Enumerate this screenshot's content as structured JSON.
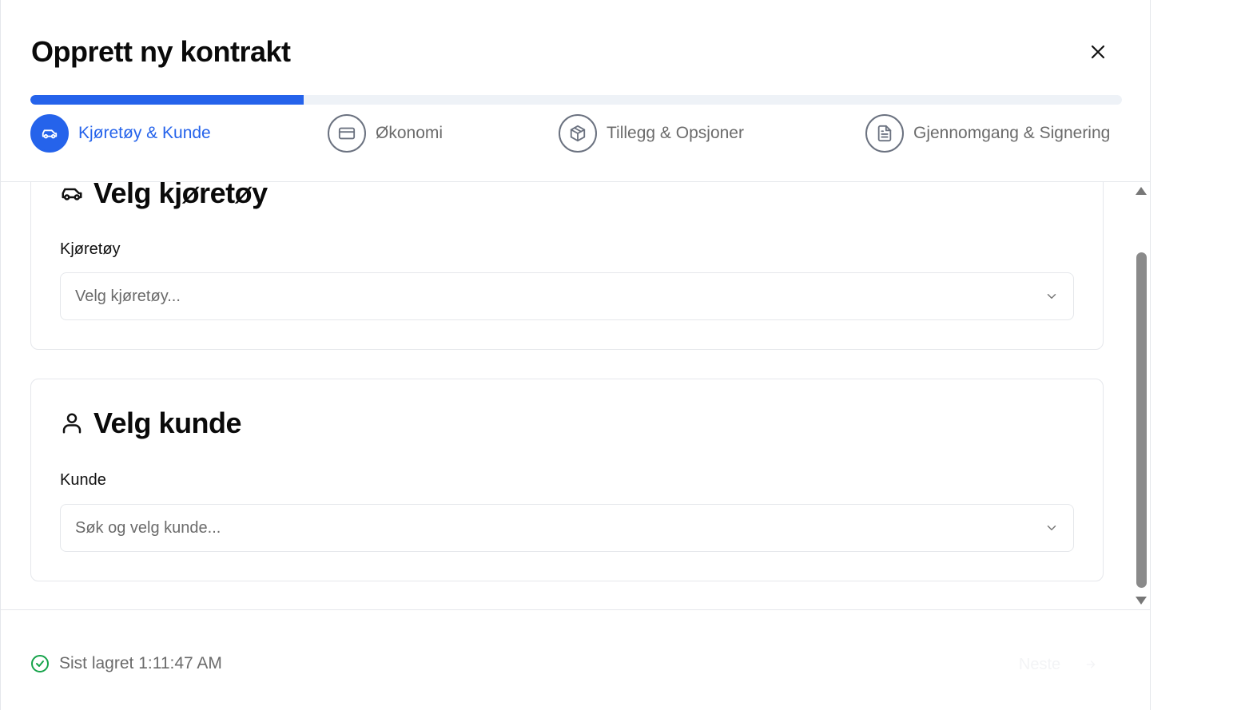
{
  "dialog": {
    "title": "Opprett ny kontrakt",
    "close_icon": "close-icon"
  },
  "progress": {
    "fraction": 0.25,
    "color": "#2563eb"
  },
  "steps": [
    {
      "label": "Kjøretøy & Kunde",
      "icon": "car-icon",
      "active": true
    },
    {
      "label": "Økonomi",
      "icon": "credit-card-icon",
      "active": false
    },
    {
      "label": "Tillegg & Opsjoner",
      "icon": "package-icon",
      "active": false
    },
    {
      "label": "Gjennomgang & Signering",
      "icon": "document-icon",
      "active": false
    }
  ],
  "vehicle_section": {
    "title": "Velg kjøretøy",
    "icon": "car-icon",
    "field_label": "Kjøretøy",
    "placeholder": "Velg kjøretøy..."
  },
  "customer_section": {
    "title": "Velg kunde",
    "icon": "user-icon",
    "field_label": "Kunde",
    "placeholder": "Søk og velg kunde..."
  },
  "footer": {
    "saved_text": "Sist lagret 1:11:47 AM",
    "saved_icon": "check-circle-icon",
    "next_label": "Neste",
    "next_icon": "arrow-right-icon"
  }
}
